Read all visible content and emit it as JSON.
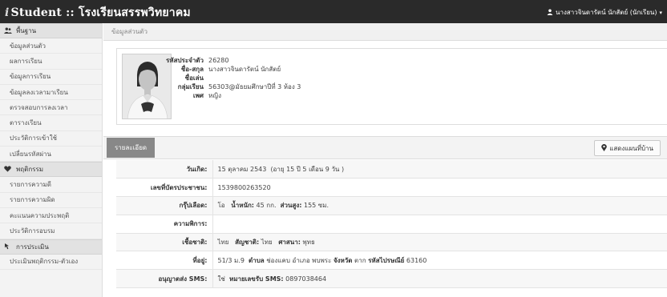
{
  "navbar": {
    "brand_prefix": "i",
    "brand_title": "Student :: โรงเรียนสรรพวิทยาคม",
    "user_name": "นางสาวจินดารัตน์ นักสัตย์ (นักเรียน)"
  },
  "sidebar": {
    "groups": [
      {
        "title": "พื้นฐาน",
        "icon": "users-icon",
        "items": [
          "ข้อมูลส่วนตัว",
          "ผลการเรียน",
          "ข้อมูลการเรียน",
          "ข้อมูลลงเวลามาเรียน",
          "ตรวจสอบการลงเวลา",
          "ตารางเรียน",
          "ประวัติการเข้าใช้",
          "เปลี่ยนรหัสผ่าน"
        ]
      },
      {
        "title": "พฤติกรรม",
        "icon": "heart-icon",
        "items": [
          "รายการความดี",
          "รายการความผิด",
          "คะแนนความประพฤติ",
          "ประวัติการอบรม"
        ]
      },
      {
        "title": "การประเมิน",
        "icon": "hand-pointer-icon",
        "items": [
          "ประเมินพฤติกรรม-ตัวเอง"
        ]
      }
    ]
  },
  "breadcrumb": "ข้อมูลส่วนตัว",
  "profile": {
    "rows": [
      {
        "label": "รหัสประจำตัว",
        "value": "26280"
      },
      {
        "label": "ชื่อ-สกุล",
        "value": "นางสาวจินดารัตน์ นักสัตย์"
      },
      {
        "label": "ชื่อเล่น",
        "value": ""
      },
      {
        "label": "กลุ่มเรียน",
        "value": "56303@มัธยมศึกษาปีที่ 3 ห้อง 3"
      },
      {
        "label": "เพศ",
        "value": "หญิง"
      }
    ]
  },
  "detail": {
    "tab_label": "รายละเอียด",
    "map_button": "แสดงแผนที่บ้าน",
    "birth": {
      "label": "วันเกิด:",
      "value": "15 ตุลาคม 2543",
      "age": "(อายุ 15 ปี 5 เดือน 9 วัน )"
    },
    "id_card": {
      "label": "เลขที่บัตรประชาชน:",
      "value": "1539800263520"
    },
    "blood": {
      "label": "กรุ๊ปเลือด:",
      "blood_value": "โอ",
      "weight_label": "น้ำหนัก:",
      "weight_value": "45 กก.",
      "height_label": "ส่วนสูง:",
      "height_value": "155 ซม."
    },
    "disability": {
      "label": "ความพิการ:",
      "value": ""
    },
    "ethnicity": {
      "label": "เชื้อชาติ:",
      "ethnicity_value": "ไทย",
      "nationality_label": "สัญชาติ:",
      "nationality_value": "ไทย",
      "religion_label": "ศาสนา:",
      "religion_value": "พุทธ"
    },
    "address": {
      "label": "ที่อยู่:",
      "house": "51/3 ม.9",
      "subdistrict_label": "ตำบล",
      "subdistrict": "ช่องแคบ",
      "district_label": "อำเภอ",
      "district": "พบพระ",
      "province_label": "จังหวัด",
      "province": "ตาก",
      "postal_label": "รหัสไปรษณีย์",
      "postal": "63160"
    },
    "sms": {
      "label": "อนุญาตส่ง SMS:",
      "value": "ใช่",
      "number_label": "หมายเลขรับ SMS:",
      "number": "0897038464"
    }
  },
  "colors": {
    "navbar": "#2a2a2a",
    "sidebar": "#f3f3f3",
    "tab": "#888888"
  }
}
